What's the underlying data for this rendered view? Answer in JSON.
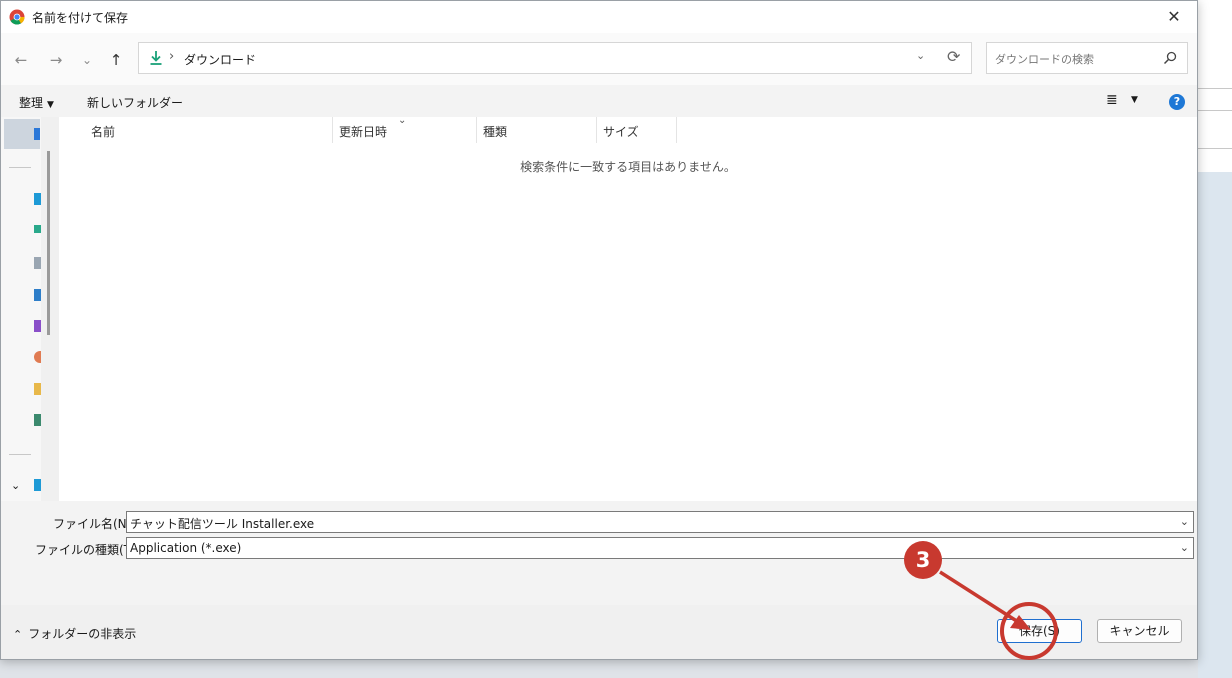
{
  "window": {
    "title": "名前を付けて保存",
    "close": "✕"
  },
  "nav": {
    "back": "←",
    "forward": "→",
    "recent": "⌄",
    "up": "↑"
  },
  "address": {
    "separator": "›",
    "current_folder": "ダウンロード",
    "dropdown": "⌄",
    "refresh": "⟳"
  },
  "search": {
    "placeholder": "ダウンロードの検索"
  },
  "toolbar": {
    "organize_label": "整理",
    "organize_caret": "▼",
    "new_folder_label": "新しいフォルダー",
    "view_icon": "≣",
    "view_caret": "▼",
    "help_label": "?"
  },
  "columns": [
    {
      "label": "名前"
    },
    {
      "label": "更新日時"
    },
    {
      "label": "種類"
    },
    {
      "label": "サイズ"
    }
  ],
  "sort_indicator": "⌄",
  "empty_message": "検索条件に一致する項目はありません。",
  "fields": {
    "filename_label": "ファイル名(N):",
    "filename_value": "チャット配信ツール Installer.exe",
    "filetype_label": "ファイルの種類(T):",
    "filetype_value": "Application (*.exe)",
    "dropdown": "⌄"
  },
  "footer": {
    "hide_folders_icon": "⌃",
    "hide_folders_label": "フォルダーの非表示",
    "save_label": "保存(S)",
    "cancel_label": "キャンセル"
  },
  "sidebar": {
    "expand_chevron": "⌄"
  },
  "annotation": {
    "step_number": "3",
    "color": "#c8392f"
  },
  "colors": {
    "accent": "#1e78d6",
    "download_icon": "#1aa179"
  }
}
